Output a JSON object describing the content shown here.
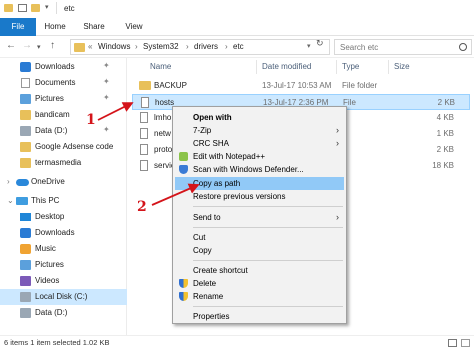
{
  "window": {
    "title": "etc"
  },
  "ribbon": {
    "tabs": [
      "File",
      "Home",
      "Share",
      "View"
    ]
  },
  "address": {
    "crumbs": [
      "Windows",
      "System32",
      "drivers",
      "etc"
    ],
    "prefix": "«"
  },
  "search": {
    "placeholder": "Search etc"
  },
  "nav": {
    "items": [
      {
        "label": "Downloads",
        "icon": "downloads-icon",
        "pinned": true
      },
      {
        "label": "Documents",
        "icon": "documents-icon",
        "pinned": true
      },
      {
        "label": "Pictures",
        "icon": "pictures-icon",
        "pinned": true
      },
      {
        "label": "bandicam",
        "icon": "folder-icon"
      },
      {
        "label": "Data (D:)",
        "icon": "drive-icon",
        "pinned": true
      },
      {
        "label": "Google Adsense code",
        "icon": "folder-icon"
      },
      {
        "label": "termasmedia",
        "icon": "folder-icon"
      },
      {
        "label": "OneDrive",
        "icon": "onedrive-icon"
      },
      {
        "label": "This PC",
        "icon": "this-pc-icon"
      },
      {
        "label": "Desktop",
        "icon": "desktop-icon"
      },
      {
        "label": "Downloads",
        "icon": "downloads-icon"
      },
      {
        "label": "Music",
        "icon": "music-icon"
      },
      {
        "label": "Pictures",
        "icon": "pictures-icon"
      },
      {
        "label": "Videos",
        "icon": "videos-icon"
      },
      {
        "label": "Local Disk (C:)",
        "icon": "drive-icon",
        "selected": true
      },
      {
        "label": "Data (D:)",
        "icon": "drive-icon"
      }
    ]
  },
  "list": {
    "columns": [
      "Name",
      "Date modified",
      "Type",
      "Size"
    ],
    "rows": [
      {
        "name": "BACKUP",
        "date": "13-Jul-17 10:53 AM",
        "type": "File folder",
        "size": ""
      },
      {
        "name": "hosts",
        "date": "13-Jul-17 2:36 PM",
        "type": "File",
        "size": "2 KB",
        "selected": true
      },
      {
        "name": "lmho",
        "date": "",
        "type": "",
        "size": "4 KB"
      },
      {
        "name": "netw",
        "date": "",
        "type": "",
        "size": "1 KB"
      },
      {
        "name": "proto",
        "date": "",
        "type": "",
        "size": "2 KB"
      },
      {
        "name": "servic",
        "date": "",
        "type": "",
        "size": "18 KB"
      }
    ]
  },
  "status": {
    "text": "6 items    1 item selected  1.02 KB"
  },
  "menu": {
    "items": [
      {
        "label": "Open with",
        "bold": true
      },
      {
        "label": "7-Zip",
        "submenu": true
      },
      {
        "label": "CRC SHA",
        "submenu": true
      },
      {
        "label": "Edit with Notepad++",
        "icon": "notepadpp-icon"
      },
      {
        "label": "Scan with Windows Defender...",
        "icon": "defender-icon"
      },
      {
        "label": "Copy as path",
        "highlighted": true
      },
      {
        "label": "Restore previous versions"
      },
      {
        "label": "Send to",
        "submenu": true
      },
      {
        "label": "Cut"
      },
      {
        "label": "Copy"
      },
      {
        "label": "Create shortcut"
      },
      {
        "label": "Delete",
        "icon": "shield-icon"
      },
      {
        "label": "Rename",
        "icon": "shield-icon"
      },
      {
        "label": "Properties"
      }
    ]
  },
  "annotations": {
    "step1": "1",
    "step2": "2"
  },
  "colors": {
    "accent": "#1979ca",
    "selection": "#cce8ff",
    "highlight": "#91c9f7",
    "annotation": "#d4141a"
  }
}
